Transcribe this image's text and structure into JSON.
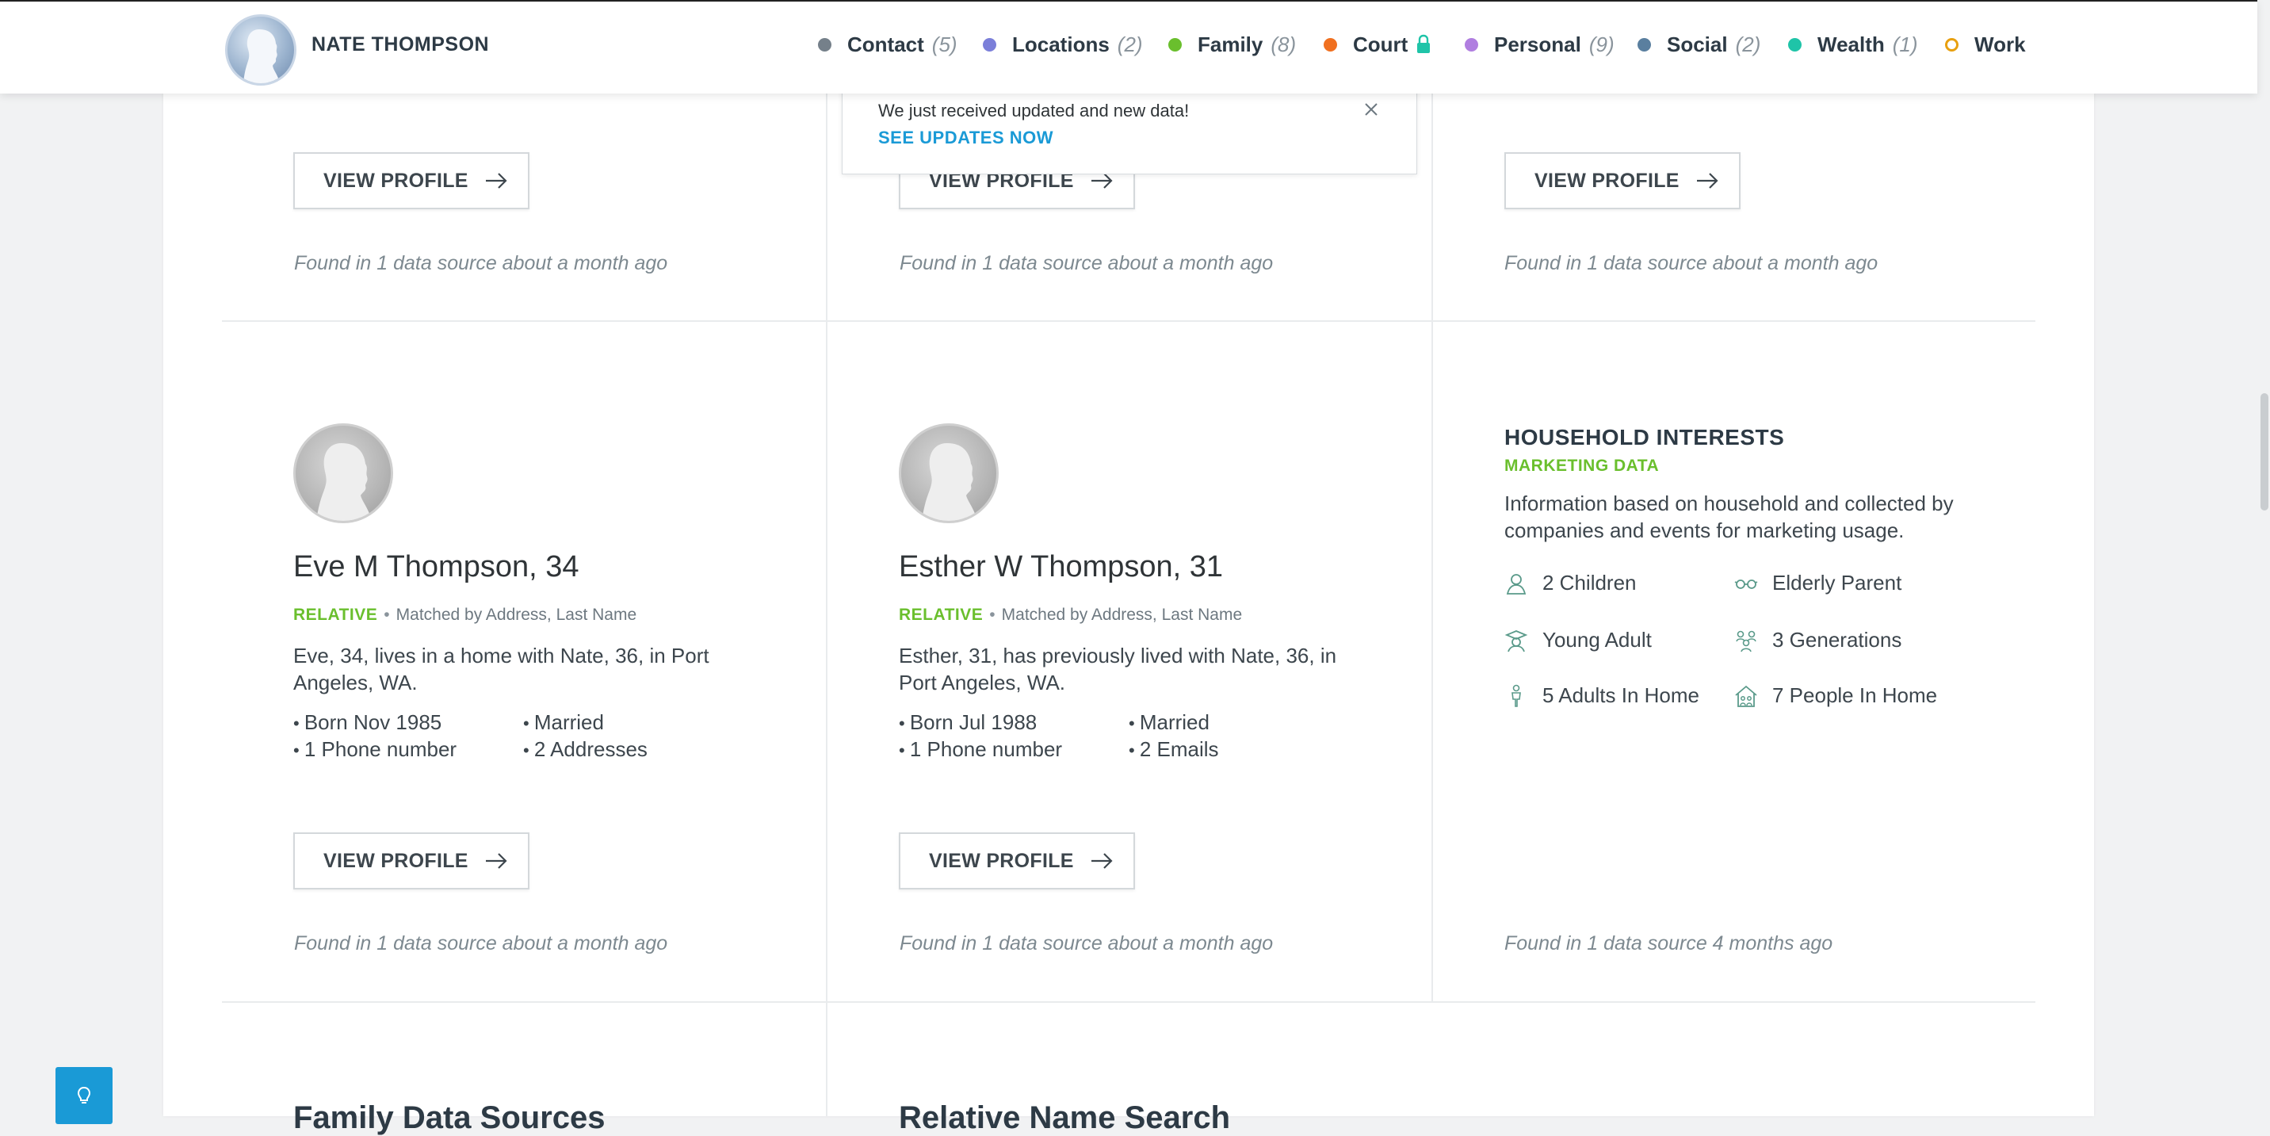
{
  "header": {
    "name": "NATE THOMPSON",
    "nav": [
      {
        "label": "Contact",
        "count": "(5)",
        "color": "#75808a",
        "hollow": false,
        "locked": false
      },
      {
        "label": "Locations",
        "count": "(2)",
        "color": "#7b7fd9",
        "hollow": false,
        "locked": false
      },
      {
        "label": "Family",
        "count": "(8)",
        "color": "#6abf2d",
        "hollow": false,
        "locked": false
      },
      {
        "label": "Court",
        "count": "",
        "color": "#f07020",
        "hollow": false,
        "locked": true
      },
      {
        "label": "Personal",
        "count": "(9)",
        "color": "#b07ee0",
        "hollow": false,
        "locked": false
      },
      {
        "label": "Social",
        "count": "(2)",
        "color": "#5a7f9f",
        "hollow": false,
        "locked": false
      },
      {
        "label": "Wealth",
        "count": "(1)",
        "color": "#1fc4a8",
        "hollow": false,
        "locked": false
      },
      {
        "label": "Work",
        "count": "",
        "color": "#e8a010",
        "hollow": true,
        "locked": false
      }
    ]
  },
  "toast": {
    "message": "We just received updated and new data!",
    "link": "SEE UPDATES NOW"
  },
  "top_row": {
    "button_label": "VIEW PROFILE",
    "found": [
      "Found in 1 data source about a month ago",
      "Found in 1 data source about a month ago",
      "Found in 1 data source about a month ago"
    ]
  },
  "relatives": [
    {
      "name": "Eve M Thompson, 34",
      "relation": "RELATIVE",
      "match": "Matched by Address, Last Name",
      "description": "Eve, 34, lives in a home with Nate, 36, in Port Angeles, WA.",
      "facts": [
        "Born Nov 1985",
        "Married",
        "1 Phone number",
        "2 Addresses"
      ],
      "button_label": "VIEW PROFILE",
      "found": "Found in 1 data source about a month ago"
    },
    {
      "name": "Esther W Thompson, 31",
      "relation": "RELATIVE",
      "match": "Matched by Address, Last Name",
      "description": "Esther, 31, has previously lived with Nate, 36, in Port Angeles, WA.",
      "facts": [
        "Born Jul 1988",
        "Married",
        "1 Phone number",
        "2 Emails"
      ],
      "button_label": "VIEW PROFILE",
      "found": "Found in 1 data source about a month ago"
    }
  ],
  "household": {
    "title": "HOUSEHOLD INTERESTS",
    "subtitle": "MARKETING DATA",
    "description": "Information based on household and collected by companies and events for marketing usage.",
    "interests": [
      {
        "label": "2 Children",
        "icon": "children-icon"
      },
      {
        "label": "Elderly Parent",
        "icon": "glasses-icon"
      },
      {
        "label": "Young Adult",
        "icon": "graduate-icon"
      },
      {
        "label": "3 Generations",
        "icon": "generations-icon"
      },
      {
        "label": "5 Adults In Home",
        "icon": "adult-icon"
      },
      {
        "label": "7 People In Home",
        "icon": "house-people-icon"
      }
    ],
    "found": "Found in 1 data source 4 months ago"
  },
  "bottom_sections": [
    "Family Data Sources",
    "Relative Name Search"
  ]
}
